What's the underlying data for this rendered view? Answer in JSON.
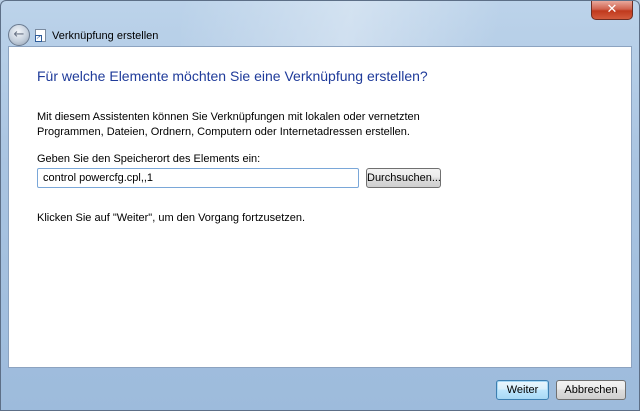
{
  "window": {
    "title": "Verknüpfung erstellen",
    "close_symbol": "✕",
    "back_symbol": "←"
  },
  "main": {
    "heading": "Für welche Elemente möchten Sie eine Verknüpfung erstellen?",
    "intro": "Mit diesem Assistenten können Sie Verknüpfungen mit lokalen oder vernetzten Programmen, Dateien, Ordnern, Computern oder Internetadressen erstellen.",
    "location_label": "Geben Sie den Speicherort des Elements ein:",
    "location_value": "control powercfg.cpl,,1",
    "browse_label": "Durchsuchen...",
    "continue_hint": "Klicken Sie auf \"Weiter\", um den Vorgang fortzusetzen."
  },
  "footer": {
    "next_label": "Weiter",
    "cancel_label": "Abbrechen"
  },
  "icons": {
    "back": "back-arrow-icon",
    "close": "close-icon",
    "wizard": "shortcut-wizard-icon"
  },
  "colors": {
    "heading": "#1f3b9a",
    "close_button": "#c0391d",
    "frame": "#a9c4e1"
  }
}
